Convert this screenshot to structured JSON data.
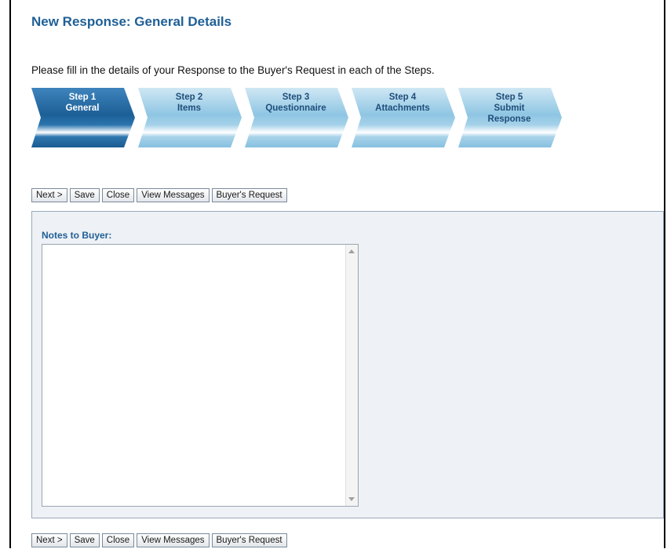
{
  "page": {
    "title": "New Response: General Details",
    "intro": "Please fill in the details of your Response to the Buyer's Request in each of the Steps."
  },
  "steps": [
    {
      "line1": "Step 1",
      "line2": "General",
      "line3": "",
      "active": true
    },
    {
      "line1": "Step 2",
      "line2": "Items",
      "line3": "",
      "active": false
    },
    {
      "line1": "Step 3",
      "line2": "Questionnaire",
      "line3": "",
      "active": false
    },
    {
      "line1": "Step 4",
      "line2": "Attachments",
      "line3": "",
      "active": false
    },
    {
      "line1": "Step 5",
      "line2": "Submit",
      "line3": "Response",
      "active": false
    }
  ],
  "buttons": {
    "next": "Next >",
    "save": "Save",
    "close": "Close",
    "view_messages": "View Messages",
    "buyers_request": "Buyer's Request"
  },
  "notes": {
    "label": "Notes to Buyer:",
    "value": ""
  },
  "colors": {
    "title": "#1f5f96",
    "step_active": "#1f5f96",
    "step_inactive": "#a9d3ea",
    "panel_bg": "#eef1f5"
  }
}
